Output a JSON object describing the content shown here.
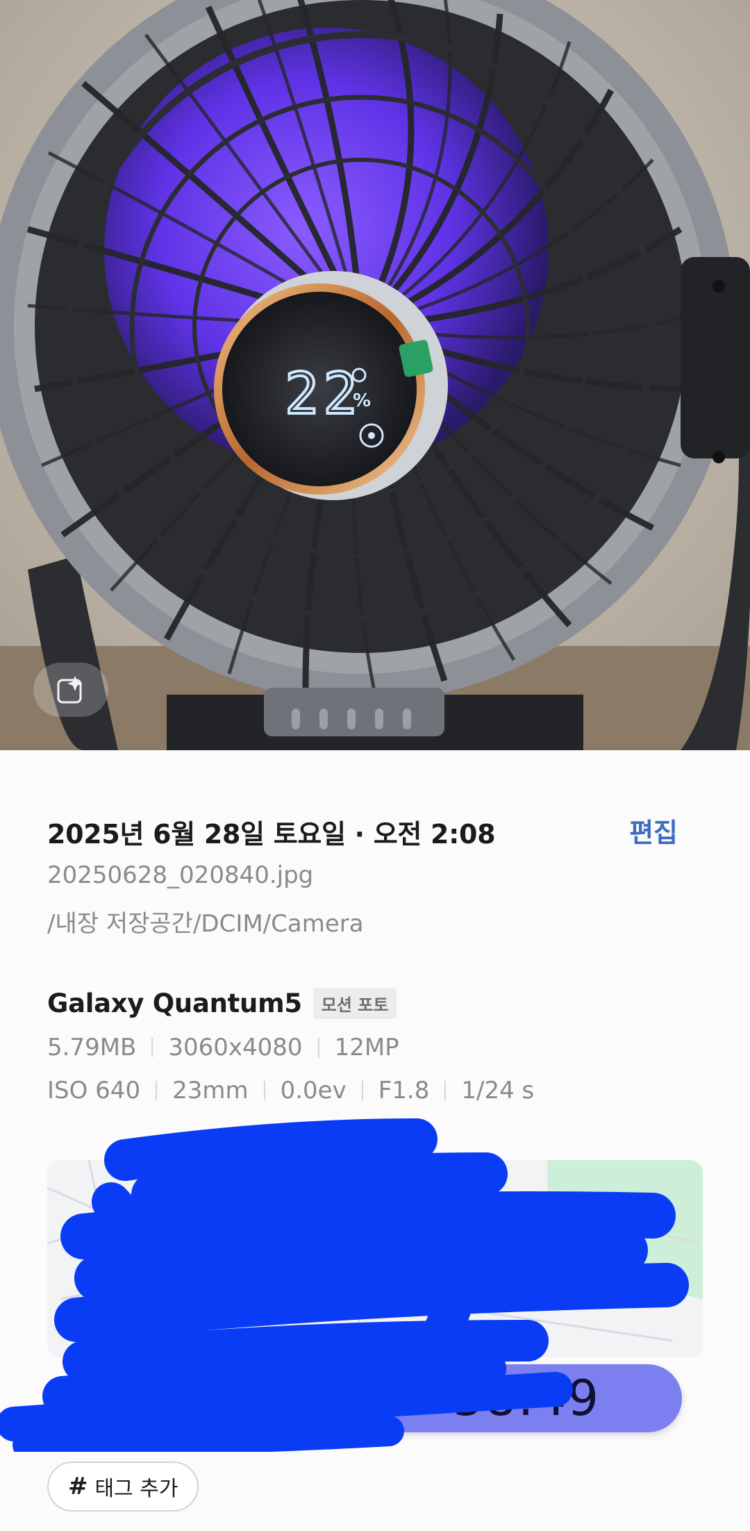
{
  "photo": {
    "display_reading": "22",
    "display_unit": "%"
  },
  "ai_edit": {
    "icon": "sparkle-edit-icon"
  },
  "details": {
    "date_time": "2025년 6월 28일 토요일 · 오전 2:08",
    "edit_label": "편집",
    "file_name": "20250628_020840.jpg",
    "file_path": "/내장 저장공간/DCIM/Camera",
    "device": "Galaxy Quantum5",
    "motion_badge": "모션 포토",
    "specs_row1": [
      "5.79MB",
      "3060x4080",
      "12MP"
    ],
    "specs_row2": [
      "ISO 640",
      "23mm",
      "0.0ev",
      "F1.8",
      "1/24 s"
    ]
  },
  "timer": {
    "value": "58:49"
  },
  "tag": {
    "icon": "hash-icon",
    "label": "태그 추가"
  },
  "colors": {
    "accent_link": "#3c6cc4",
    "timer_pill": "#7b7ff0",
    "scribble": "#0a3cf5",
    "fan_light": "#6a3cf0"
  }
}
